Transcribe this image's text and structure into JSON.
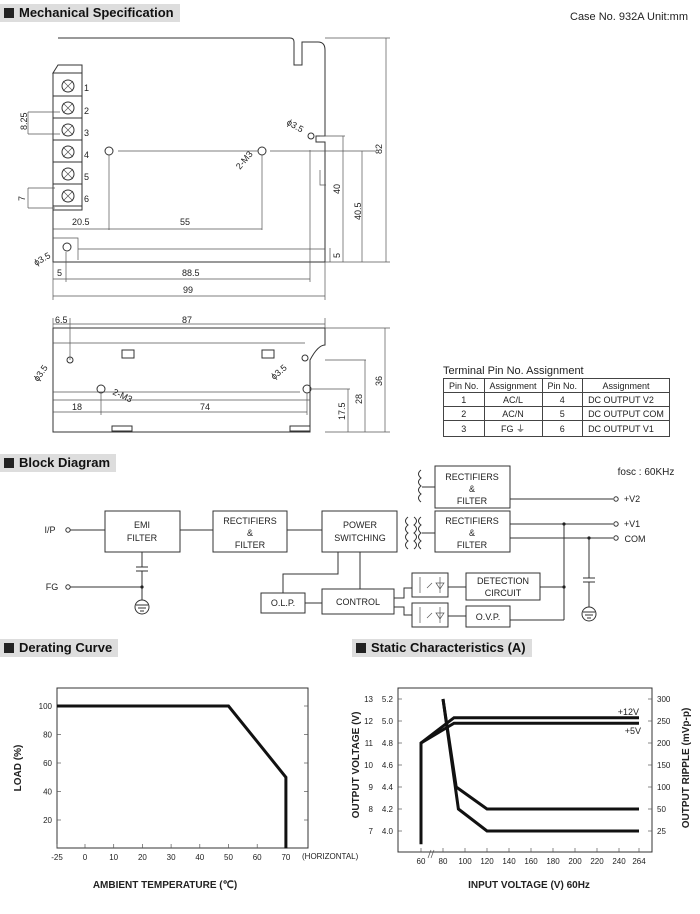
{
  "header": {
    "case_no": "Case No. 932A   Unit:mm"
  },
  "sections": {
    "mechanical": "Mechanical Specification",
    "block": "Block Diagram",
    "derating": "Derating Curve",
    "static": "Static Characteristics (A)"
  },
  "mechanical": {
    "top_view": {
      "terminals": [
        "1",
        "2",
        "3",
        "4",
        "5",
        "6"
      ],
      "dims": {
        "pitch": "8.25",
        "term_w": "7",
        "d20_5": "20.5",
        "d55": "55",
        "d5a": "5",
        "d88_5": "88.5",
        "d99": "99",
        "h82": "82",
        "h40": "40",
        "h40_5": "40.5",
        "h5": "5",
        "hole_a": "ϕ3.5",
        "hole_b": "ϕ3.5",
        "m3": "2-M3"
      }
    },
    "side_view": {
      "dims": {
        "d6_5": "6.5",
        "d87": "87",
        "d18": "18",
        "d74": "74",
        "h36": "36",
        "h28": "28",
        "h17_5": "17.5",
        "hole_a": "ϕ3.5",
        "hole_b": "ϕ3.5",
        "m3": "2-M3"
      }
    }
  },
  "pin_table": {
    "caption": "Terminal Pin No.  Assignment",
    "headers": [
      "Pin No.",
      "Assignment",
      "Pin No.",
      "Assignment"
    ],
    "rows": [
      [
        "1",
        "AC/L",
        "4",
        "DC OUTPUT V2"
      ],
      [
        "2",
        "AC/N",
        "5",
        "DC OUTPUT COM"
      ],
      [
        "3",
        "FG ⏚",
        "6",
        "DC OUTPUT V1"
      ]
    ]
  },
  "block_diagram": {
    "fosc": "fosc : 60KHz",
    "ip": "I/P",
    "fg": "FG",
    "v2": "+V2",
    "v1": "+V1",
    "com": "COM",
    "emi": [
      "EMI",
      "FILTER"
    ],
    "rect1": [
      "RECTIFIERS",
      "&",
      "FILTER"
    ],
    "psw": [
      "POWER",
      "SWITCHING"
    ],
    "rect2": [
      "RECTIFIERS",
      "&",
      "FILTER"
    ],
    "rect3": [
      "RECTIFIERS",
      "&",
      "FILTER"
    ],
    "olp": "O.L.P.",
    "control": "CONTROL",
    "detect": [
      "DETECTION",
      "CIRCUIT"
    ],
    "ovp": "O.V.P."
  },
  "chart_data": [
    {
      "type": "line",
      "title": "",
      "xlabel": "AMBIENT TEMPERATURE (℃)",
      "ylabel": "LOAD (%)",
      "x_note": "(HORIZONTAL)",
      "xticks": [
        "-25",
        "0",
        "10",
        "20",
        "30",
        "40",
        "50",
        "60",
        "70"
      ],
      "yticks": [
        "20",
        "40",
        "60",
        "80",
        "100"
      ],
      "ylim": [
        0,
        110
      ],
      "grid": false,
      "series": [
        {
          "x": [
            -25,
            50,
            70,
            70
          ],
          "y": [
            100,
            100,
            50,
            0
          ]
        }
      ]
    },
    {
      "type": "line",
      "title": "",
      "xlabel": "INPUT VOLTAGE (V) 60Hz",
      "ylabel": "OUTPUT VOLTAGE (V)",
      "y2label": "OUTPUT RIPPLE (mVp-p)",
      "xticks": [
        "60",
        "80",
        "100",
        "120",
        "140",
        "160",
        "180",
        "200",
        "220",
        "240",
        "264"
      ],
      "yticks_12v": [
        "7",
        "8",
        "9",
        "10",
        "11",
        "12",
        "13"
      ],
      "yticks_5v": [
        "4.0",
        "4.2",
        "4.4",
        "4.6",
        "4.8",
        "5.0",
        "5.2"
      ],
      "yticks_ripple": [
        "25",
        "50",
        "100",
        "150",
        "200",
        "250",
        "300"
      ],
      "grid": false,
      "series": [
        {
          "name": "+12V",
          "axis": "12V",
          "x": [
            60,
            60,
            90,
            264
          ],
          "y": [
            6.4,
            11,
            12.15,
            12.15
          ]
        },
        {
          "name": "+5V",
          "axis": "5V",
          "x": [
            60,
            90,
            264
          ],
          "y": [
            4.8,
            4.98,
            4.98
          ]
        },
        {
          "axis": "ripple",
          "x": [
            80,
            92,
            120,
            264
          ],
          "y": [
            300,
            100,
            50,
            50
          ]
        },
        {
          "axis": "ripple",
          "x": [
            80,
            94,
            120,
            264
          ],
          "y": [
            300,
            50,
            25,
            25
          ]
        }
      ]
    }
  ]
}
